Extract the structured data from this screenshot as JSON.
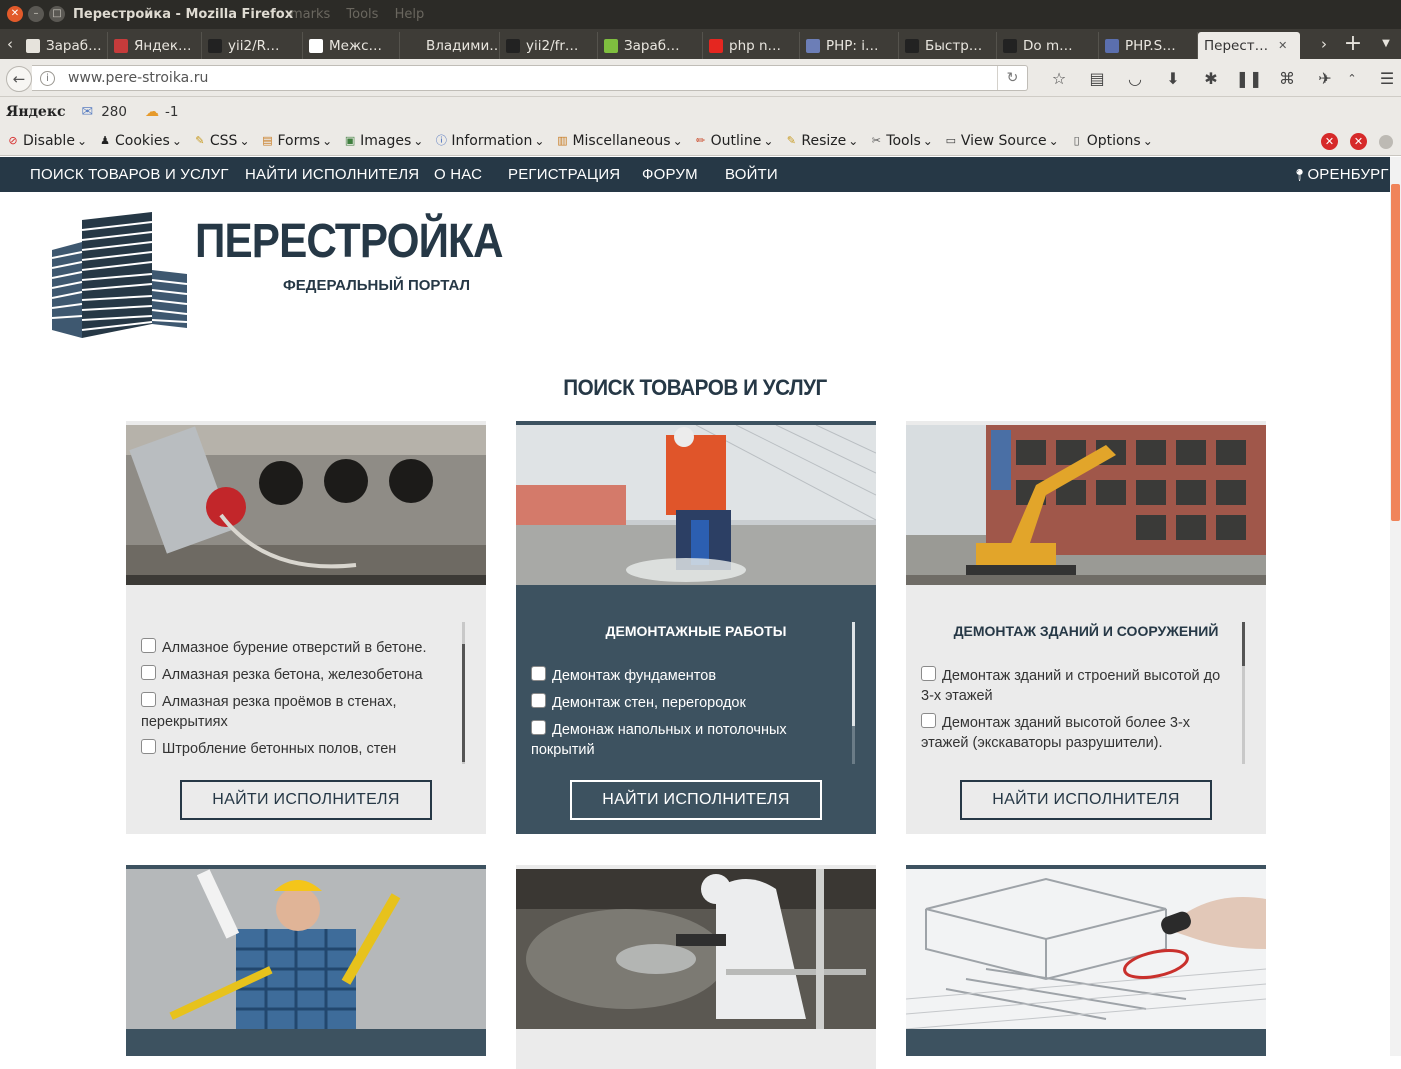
{
  "window": {
    "title": "Перестройка - Mozilla Firefox",
    "ghost_menu": "marks  Tools  Help"
  },
  "tabs": [
    {
      "label": "Зараб…",
      "favicon_color": "#e6e3dc"
    },
    {
      "label": "Яндек…",
      "favicon_color": "#c63b3b"
    },
    {
      "label": "yii2/R…",
      "favicon_color": "#222222"
    },
    {
      "label": "Межс…",
      "favicon_color": "#ffffff"
    },
    {
      "label": "Владими…",
      "favicon_color": "#3e3c37"
    },
    {
      "label": "yii2/fr…",
      "favicon_color": "#222222"
    },
    {
      "label": "Зараб…",
      "favicon_color": "#7fbf3f"
    },
    {
      "label": "php n…",
      "favicon_color": "#e52620"
    },
    {
      "label": "PHP: i…",
      "favicon_color": "#6c7eb7"
    },
    {
      "label": "Быстр…",
      "favicon_color": "#222222"
    },
    {
      "label": "Do m…",
      "favicon_color": "#222222"
    },
    {
      "label": "PHP.S…",
      "favicon_color": "#5b6fae"
    },
    {
      "label": "Перест…",
      "favicon_color": "#eceae6"
    }
  ],
  "address": {
    "url": "www.pere-stroika.ru"
  },
  "yandex_bar": {
    "logo": "Яндекс",
    "mail_count": "280",
    "weather": "-1"
  },
  "webdev_toolbar": {
    "items": [
      "Disable",
      "Cookies",
      "CSS",
      "Forms",
      "Images",
      "Information",
      "Miscellaneous",
      "Outline",
      "Resize",
      "Tools",
      "View Source",
      "Options"
    ]
  },
  "site": {
    "nav": [
      "ПОИСК ТОВАРОВ И УСЛУГ",
      "НАЙТИ ИСПОЛНИТЕЛЯ",
      "О НАС",
      "РЕГИСТРАЦИЯ",
      "ФОРУМ",
      "ВОЙТИ"
    ],
    "city": "ОРЕНБУРГ",
    "brand": "ПЕРЕСТРОЙКА",
    "brand_sub": "ФЕДЕРАЛЬНЫЙ ПОРТАЛ",
    "section_title": "ПОИСК ТОВАРОВ И УСЛУГ",
    "accent": "#263846",
    "cards": [
      {
        "title": "",
        "items": [
          "Алмазное бурение отверстий в бетоне.",
          "Алмазная резка бетона, железобетона",
          "Алмазная резка проёмов в стенах, перекрытиях",
          "Штробление бетонных полов, стен"
        ],
        "button": "НАЙТИ ИСПОЛНИТЕЛЯ"
      },
      {
        "title": "ДЕМОНТАЖНЫЕ РАБОТЫ",
        "items": [
          "Демонтаж фундаментов",
          "Демонтаж стен, перегородок",
          "Демонаж напольных и потолочных покрытий"
        ],
        "button": "НАЙТИ ИСПОЛНИТЕЛЯ"
      },
      {
        "title": "ДЕМОНТАЖ ЗДАНИЙ И СООРУЖЕНИЙ",
        "items": [
          "Демонтаж зданий и строений высотой до 3-х этажей",
          "Демонтаж зданий высотой более 3-х этажей (экскаваторы разрушители)."
        ],
        "button": "НАЙТИ ИСПОЛНИТЕЛЯ"
      }
    ]
  }
}
